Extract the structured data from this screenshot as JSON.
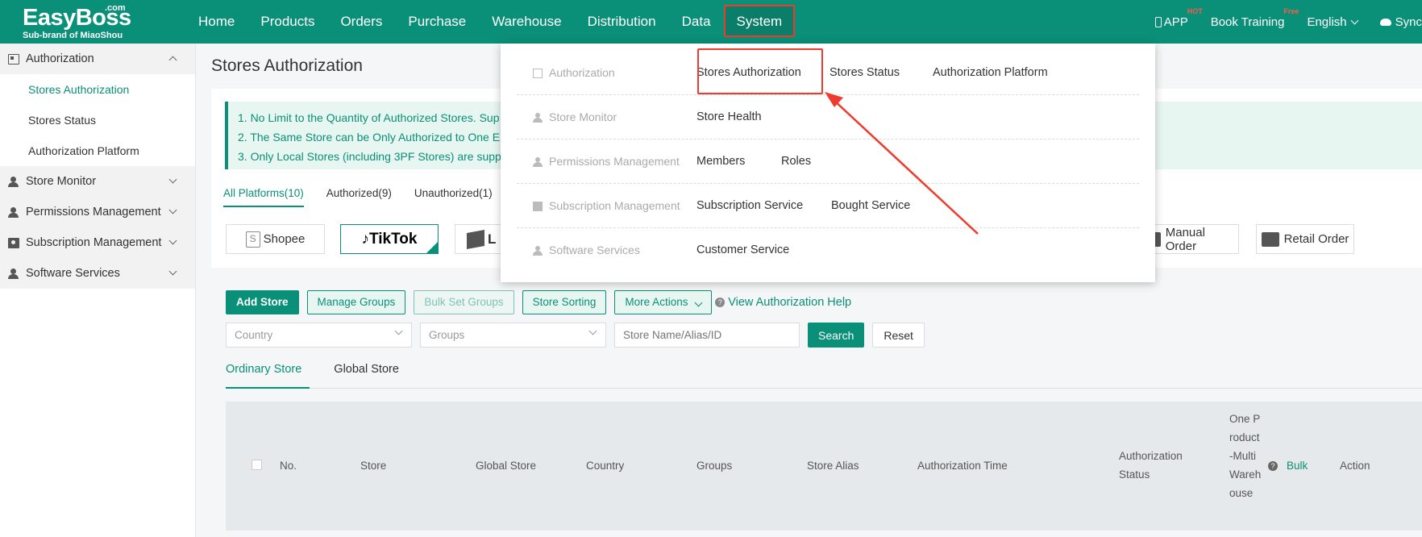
{
  "header": {
    "logo": {
      "brand": "EasyBoss",
      "suffix": ".com",
      "sub": "Sub-brand of MiaoShou"
    },
    "nav": [
      "Home",
      "Products",
      "Orders",
      "Purchase",
      "Warehouse",
      "Distribution",
      "Data",
      "System"
    ],
    "right": {
      "app": "APP",
      "app_badge": "HOT",
      "training": "Book Training",
      "training_badge": "Free",
      "language": "English",
      "sync": "Sync"
    }
  },
  "sidebar": {
    "groups": [
      {
        "label": "Authorization",
        "icon": "authorization-icon",
        "open": true,
        "items": [
          "Stores Authorization",
          "Stores Status",
          "Authorization Platform"
        ]
      },
      {
        "label": "Store Monitor",
        "icon": "person-icon"
      },
      {
        "label": "Permissions Management",
        "icon": "person-icon"
      },
      {
        "label": "Subscription Management",
        "icon": "subscription-icon"
      },
      {
        "label": "Software Services",
        "icon": "person-icon"
      }
    ]
  },
  "main": {
    "title": "Stores Authorization",
    "notices": [
      "1. No Limit to the Quantity of Authorized Stores. Sup",
      "2. The Same Store can be Only Authorized to One E",
      "3. Only Local Stores (including 3PF Stores) are supp"
    ],
    "platform_tabs": [
      "All Platforms(10)",
      "Authorized(9)",
      "Unauthorized(1)"
    ],
    "platforms": {
      "shopee": "Shopee",
      "tiktok": "TikTok",
      "lazada_partial": "L",
      "manual": "Manual Order",
      "retail": "Retail Order"
    },
    "toolbar": {
      "add_store": "Add Store",
      "manage_groups": "Manage Groups",
      "bulk_set_groups": "Bulk Set Groups",
      "store_sorting": "Store Sorting",
      "more_actions": "More Actions",
      "help": "View Authorization Help"
    },
    "filters": {
      "country_placeholder": "Country",
      "groups_placeholder": "Groups",
      "search_placeholder": "Store Name/Alias/ID",
      "search": "Search",
      "reset": "Reset"
    },
    "store_tabs": [
      "Ordinary Store",
      "Global Store"
    ],
    "table_headers": {
      "no": "No.",
      "store": "Store",
      "global_store": "Global Store",
      "country": "Country",
      "groups": "Groups",
      "alias": "Store Alias",
      "auth_time": "Authorization Time",
      "auth_status": "Authorization Status",
      "one_product": "One Product-Multi Warehouse",
      "bulk": "Bulk",
      "action": "Action"
    }
  },
  "dropdown": {
    "rows": [
      {
        "category": "Authorization",
        "links": [
          "Stores Authorization",
          "Stores Status",
          "Authorization Platform"
        ]
      },
      {
        "category": "Store Monitor",
        "links": [
          "Store Health"
        ]
      },
      {
        "category": "Permissions Management",
        "links": [
          "Members",
          "Roles"
        ]
      },
      {
        "category": "Subscription Management",
        "links": [
          "Subscription Service",
          "Bought Service"
        ]
      },
      {
        "category": "Software Services",
        "links": [
          "Customer Service"
        ]
      }
    ]
  },
  "colors": {
    "brand": "#0a8f78",
    "highlight": "#ef3b2d"
  }
}
